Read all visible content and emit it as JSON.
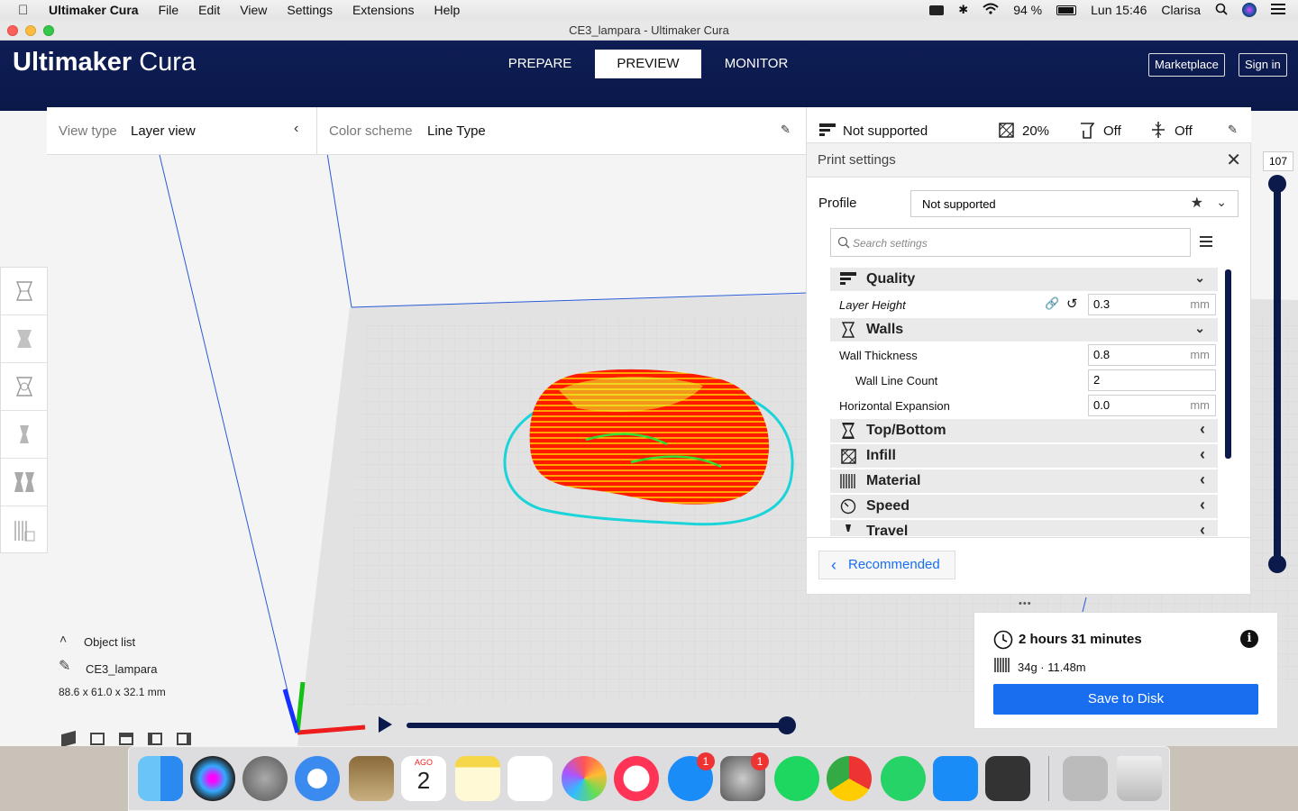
{
  "menubar": {
    "app_name": "Ultimaker Cura",
    "items": [
      "File",
      "Edit",
      "View",
      "Settings",
      "Extensions",
      "Help"
    ],
    "battery": "94 %",
    "clock": "Lun 15:46",
    "user": "Clarisa"
  },
  "window": {
    "title": "CE3_lampara - Ultimaker Cura"
  },
  "header": {
    "logo_bold": "Ultimaker",
    "logo_light": "Cura",
    "tabs": [
      "PREPARE",
      "PREVIEW",
      "MONITOR"
    ],
    "active_tab": "PREVIEW",
    "marketplace": "Marketplace",
    "signin": "Sign in"
  },
  "view_panel": {
    "label": "View type",
    "value": "Layer view"
  },
  "color_panel": {
    "label": "Color scheme",
    "value": "Line Type"
  },
  "print_summary": {
    "profile": "Not supported",
    "infill": "20%",
    "support": "Off",
    "adhesion": "Off"
  },
  "print_settings": {
    "title": "Print settings",
    "profile_label": "Profile",
    "profile_value": "Not supported",
    "search_placeholder": "Search settings",
    "categories": {
      "quality": "Quality",
      "walls": "Walls",
      "topbottom": "Top/Bottom",
      "infill": "Infill",
      "material": "Material",
      "speed": "Speed",
      "travel": "Travel"
    },
    "settings": {
      "layer_height": {
        "label": "Layer Height",
        "value": "0.3",
        "unit": "mm"
      },
      "wall_thickness": {
        "label": "Wall Thickness",
        "value": "0.8",
        "unit": "mm"
      },
      "wall_line_count": {
        "label": "Wall Line Count",
        "value": "2"
      },
      "horizontal_expansion": {
        "label": "Horizontal Expansion",
        "value": "0.0",
        "unit": "mm"
      }
    },
    "recommended": "Recommended"
  },
  "layer_slider": {
    "top_value": "107"
  },
  "object_list": {
    "title": "Object list",
    "object_name": "CE3_lampara",
    "dimensions": "88.6 x 61.0 x 32.1 mm"
  },
  "estimate": {
    "time": "2 hours 31 minutes",
    "material": "34g · 11.48m",
    "save": "Save to Disk"
  },
  "dock": {
    "calendar_month": "AGO",
    "calendar_day": "2",
    "appstore_badge": "1",
    "prefs_badge": "1"
  },
  "colors": {
    "header": "#0b1a4a",
    "accent": "#196ef0",
    "model": "#ff1a00",
    "outline": "#1ad4d9"
  }
}
